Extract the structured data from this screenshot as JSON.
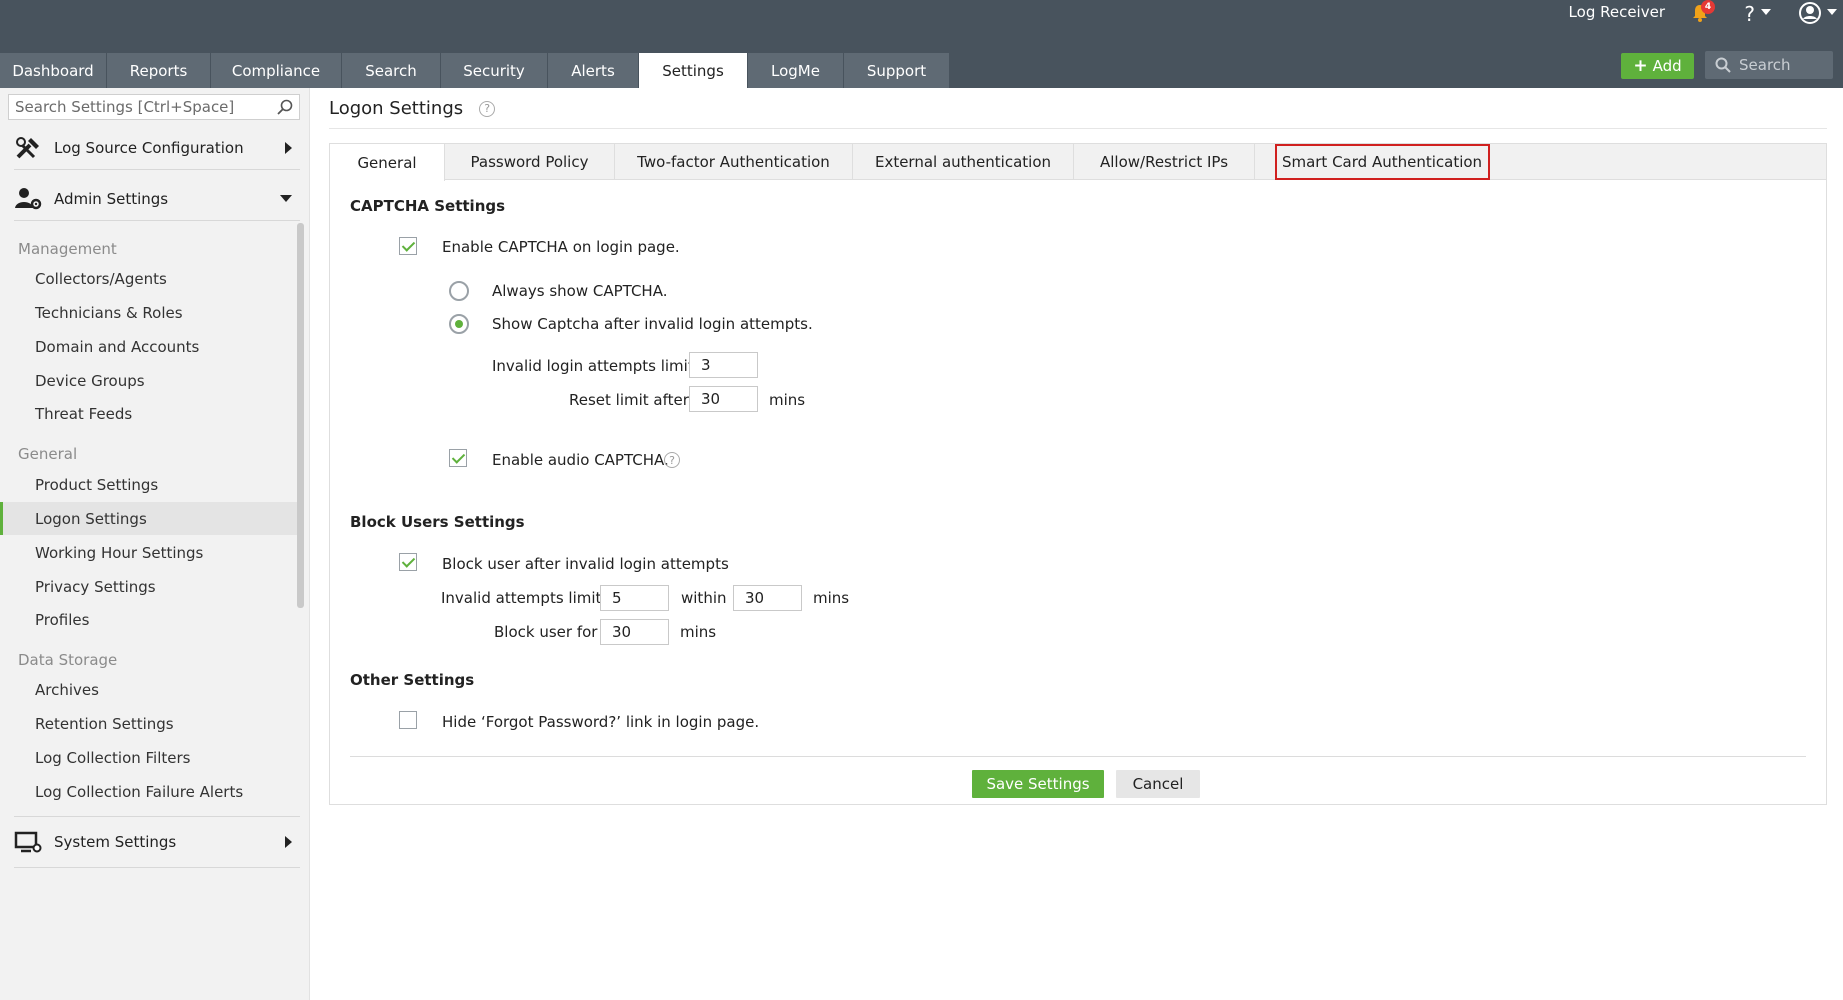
{
  "header": {
    "log_receiver": "Log Receiver",
    "notification_count": "4",
    "help": "?",
    "nav_tabs": [
      "Dashboard",
      "Reports",
      "Compliance",
      "Search",
      "Security",
      "Alerts",
      "Settings",
      "LogMe",
      "Support"
    ],
    "active_tab": "Settings",
    "add_label": "Add",
    "search_placeholder": "Search"
  },
  "sidebar": {
    "search_placeholder": "Search Settings [Ctrl+Space]",
    "groups": {
      "log_source": "Log Source Configuration",
      "admin": "Admin Settings",
      "system": "System Settings"
    },
    "sections": {
      "management": {
        "title": "Management",
        "items": [
          "Collectors/Agents",
          "Technicians & Roles",
          "Domain and Accounts",
          "Device Groups",
          "Threat Feeds"
        ]
      },
      "general": {
        "title": "General",
        "items": [
          "Product Settings",
          "Logon Settings",
          "Working Hour Settings",
          "Privacy Settings",
          "Profiles"
        ]
      },
      "data_storage": {
        "title": "Data Storage",
        "items": [
          "Archives",
          "Retention Settings",
          "Log Collection Filters",
          "Log Collection Failure Alerts"
        ]
      }
    },
    "active_item": "Logon Settings"
  },
  "main": {
    "title": "Logon Settings",
    "subtabs": [
      "General",
      "Password Policy",
      "Two-factor Authentication",
      "External authentication",
      "Allow/Restrict IPs",
      "Smart Card Authentication"
    ],
    "active_subtab": "General",
    "highlighted_subtab": "Smart Card Authentication",
    "captcha": {
      "title": "CAPTCHA Settings",
      "enable_label": "Enable CAPTCHA on login page.",
      "enable_checked": true,
      "always_label": "Always show CAPTCHA.",
      "after_invalid_label": "Show Captcha after invalid login attempts.",
      "selected_option": "after_invalid",
      "invalid_limit_label": "Invalid login attempts limit",
      "invalid_limit_value": "3",
      "reset_label": "Reset limit after",
      "reset_value": "30",
      "reset_unit": "mins",
      "audio_label": "Enable audio CAPTCHA.",
      "audio_checked": true
    },
    "block_users": {
      "title": "Block Users Settings",
      "block_label": "Block user after invalid login attempts",
      "block_checked": true,
      "attempts_label": "Invalid attempts limit",
      "attempts_value": "5",
      "within_label": "within",
      "within_value": "30",
      "within_unit": "mins",
      "block_for_label": "Block user for",
      "block_for_value": "30",
      "block_for_unit": "mins"
    },
    "other": {
      "title": "Other Settings",
      "hide_forgot_label": "Hide ‘Forgot Password?’ link in login page.",
      "hide_forgot_checked": false
    },
    "save_label": "Save Settings",
    "cancel_label": "Cancel"
  },
  "colors": {
    "topbar": "#48535d",
    "nav_tab": "#5f6a74",
    "accent_green": "#5fb13c",
    "highlight_red": "#d0201f"
  }
}
